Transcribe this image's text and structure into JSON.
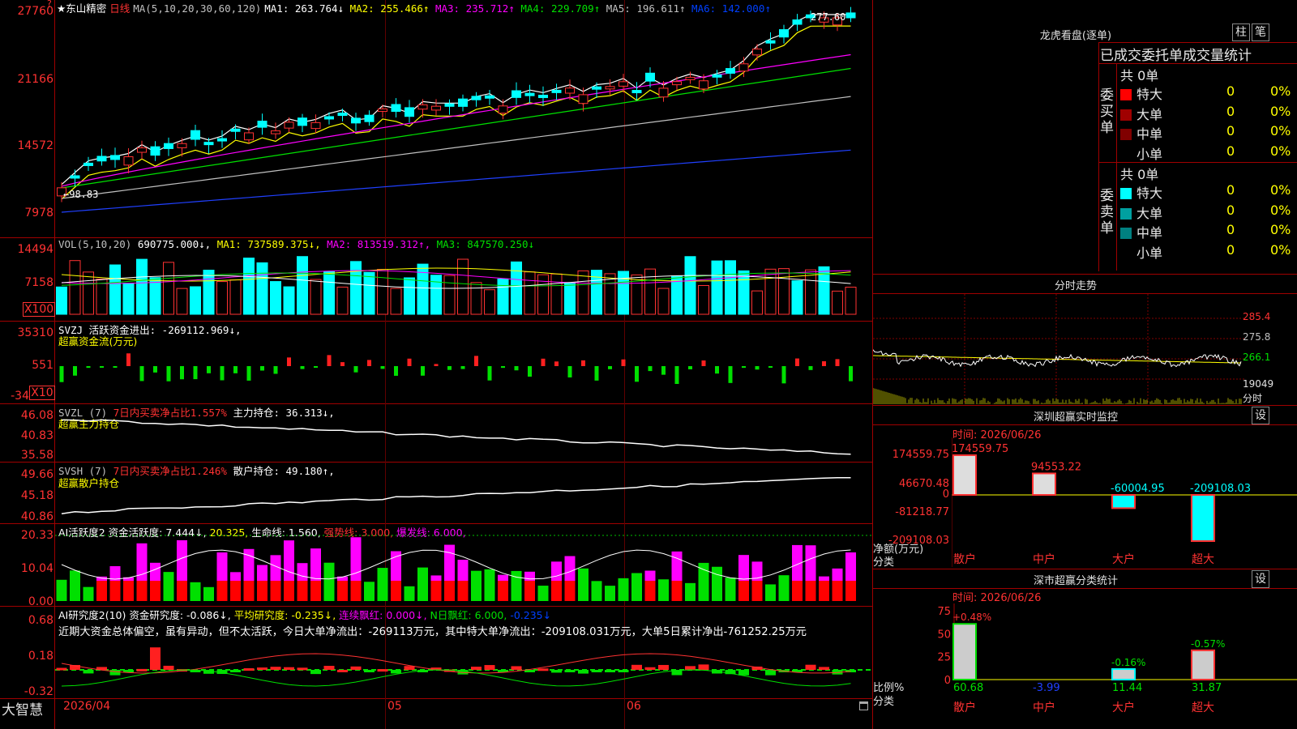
{
  "stock": {
    "name": "东山精密",
    "period": "日线",
    "star": "★",
    "flag_top": "?"
  },
  "ma_header": {
    "label": "MA(5,10,20,30,60,120)",
    "items": [
      {
        "text": "MA1: 263.764↓",
        "color": "#ffffff"
      },
      {
        "text": "MA2: 255.466↑",
        "color": "#ffff00"
      },
      {
        "text": "MA3: 235.712↑",
        "color": "#ff00ff"
      },
      {
        "text": "MA4: 229.709↑",
        "color": "#00e000"
      },
      {
        "text": "MA5: 196.611↑",
        "color": "#c0c0c0"
      },
      {
        "text": "MA6: 142.000↑",
        "color": "#0040ff"
      }
    ]
  },
  "price_axis": [
    "27760",
    "21166",
    "14572",
    "7978"
  ],
  "price_annotations": {
    "high": "277.60",
    "low": "98.83"
  },
  "vol": {
    "axis": [
      "14494",
      "7158",
      "X100"
    ],
    "header": [
      {
        "text": "VOL(5,10,20)",
        "color": "#c0c0c0"
      },
      {
        "text": "690775.000↓,",
        "color": "#ffffff"
      },
      {
        "text": "MA1: 737589.375↓,",
        "color": "#ffff00"
      },
      {
        "text": "MA2: 813519.312↑,",
        "color": "#ff00ff"
      },
      {
        "text": "MA3: 847570.250↓",
        "color": "#00e000"
      }
    ]
  },
  "svzj": {
    "axis": [
      "35310",
      "551",
      "-34",
      "X10"
    ],
    "header": "SVZJ  活跃资金进出: -269112.969↓,",
    "sub": "超赢资金流(万元)"
  },
  "svzl": {
    "axis": [
      "46.08",
      "40.83",
      "35.58"
    ],
    "name": "SVZL (7)",
    "pct": "7日内买卖净占比1.557%",
    "hold": "主力持仓: 36.313↓,",
    "sub": "超赢主力持仓"
  },
  "svsh": {
    "axis": [
      "49.66",
      "45.18",
      "40.86"
    ],
    "name": "SVSH (7)",
    "pct": "7日内买卖净占比1.246%",
    "hold": "散户持仓: 49.180↑,",
    "sub": "超赢散户持仓"
  },
  "ai_act": {
    "axis": [
      "20.33",
      "10.04",
      "0.00"
    ],
    "items": [
      {
        "text": "AI活跃度2 资金活跃度: 7.444↓,",
        "color": "#ffffff"
      },
      {
        "text": "20.325,",
        "color": "#ffff00"
      },
      {
        "text": "生命线: 1.560,",
        "color": "#ffffff"
      },
      {
        "text": "强势线: 3.000,",
        "color": "#ff3232"
      },
      {
        "text": "爆发线: 6.000,",
        "color": "#ff00ff"
      }
    ]
  },
  "ai_res": {
    "axis": [
      "0.68",
      "0.18",
      "-0.32"
    ],
    "items": [
      {
        "text": "AI研究度2(10) 资金研究度: -0.086↓,",
        "color": "#ffffff"
      },
      {
        "text": "平均研究度: -0.235↓,",
        "color": "#ffff00"
      },
      {
        "text": "连续飘红: 0.000↓,",
        "color": "#ff00ff"
      },
      {
        "text": "N日飘红: 6.000,",
        "color": "#00e000"
      },
      {
        "text": "-0.235↓",
        "color": "#0040ff"
      }
    ],
    "comment": "近期大资金总体偏空，虽有异动，但不太活跃，今日大单净流出：-269113万元，其中特大单净流出：-209108.031万元，大单5日累计净出-761252.25万元"
  },
  "xaxis": {
    "start": "2026/04",
    "m5": "05",
    "m6": "06"
  },
  "bottom_left": "大智慧",
  "right": {
    "lhb_title": "龙虎看盘(逐单)",
    "btn_zhu": "柱",
    "btn_bi": "笔",
    "stats_title": "已成交委托单成交量统计",
    "buy_label": "委买单",
    "sell_label": "委卖单",
    "buy_total": "共 0单",
    "sell_total": "共 0单",
    "buy_rows": [
      {
        "label": "特大",
        "count": "0",
        "pct": "0%",
        "color": "#ff0000"
      },
      {
        "label": "大单",
        "count": "0",
        "pct": "0%",
        "color": "#a00000"
      },
      {
        "label": "中单",
        "count": "0",
        "pct": "0%",
        "color": "#800000"
      },
      {
        "label": "小单",
        "count": "0",
        "pct": "0%",
        "color": ""
      }
    ],
    "sell_rows": [
      {
        "label": "特大",
        "count": "0",
        "pct": "0%",
        "color": "#00ffff"
      },
      {
        "label": "大单",
        "count": "0",
        "pct": "0%",
        "color": "#00a0a0"
      },
      {
        "label": "中单",
        "count": "0",
        "pct": "0%",
        "color": "#008080"
      },
      {
        "label": "小单",
        "count": "0",
        "pct": "0%",
        "color": ""
      }
    ],
    "fenshi_title": "分时走势",
    "fenshi_axis": [
      "285.4",
      "275.8",
      "266.1",
      "19049",
      "分时"
    ],
    "sz_title": "深圳超赢实时监控",
    "sz_btn": "设",
    "sz_time": "时间: 2026/06/26",
    "sz_axis": [
      "174559.75",
      "46670.48",
      "0",
      "-81218.77",
      "-209108.03"
    ],
    "sz_ylabel": "净额(万元)",
    "sz_xlabel": "分类",
    "sz_bars": [
      {
        "cat": "散户",
        "value": 174559.75,
        "label": "174559.75"
      },
      {
        "cat": "中户",
        "value": 94553.22,
        "label": "94553.22"
      },
      {
        "cat": "大户",
        "value": -60004.95,
        "label": "-60004.95"
      },
      {
        "cat": "超大",
        "value": -209108.03,
        "label": "-209108.03"
      }
    ],
    "cat_title": "深市超赢分类统计",
    "cat_btn": "设",
    "cat_time": "时间: 2026/06/26",
    "cat_axis": [
      "75",
      "50",
      "25",
      "0"
    ],
    "cat_ylabel": "比例%",
    "cat_xlabel": "分类",
    "cat_bars": [
      {
        "cat": "散户",
        "pct": 60.68,
        "label_top": "+0.48%",
        "label_bottom": "60.68"
      },
      {
        "cat": "中户",
        "pct": -3.99,
        "label_top": "",
        "label_bottom": "-3.99"
      },
      {
        "cat": "大户",
        "pct": 11.44,
        "label_top": "-0.16%",
        "label_bottom": "11.44"
      },
      {
        "cat": "超大",
        "pct": 31.87,
        "label_top": "-0.57%",
        "label_bottom": "31.87"
      }
    ]
  }
}
